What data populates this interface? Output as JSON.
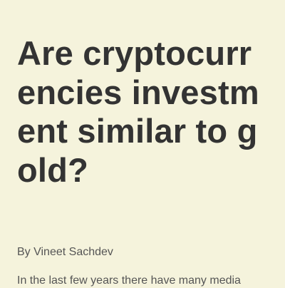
{
  "article": {
    "title": "Are cryptocurrencies investment similar to gold?",
    "byline": "By Vineet Sachdev",
    "intro": "In the last few years there have many media"
  }
}
